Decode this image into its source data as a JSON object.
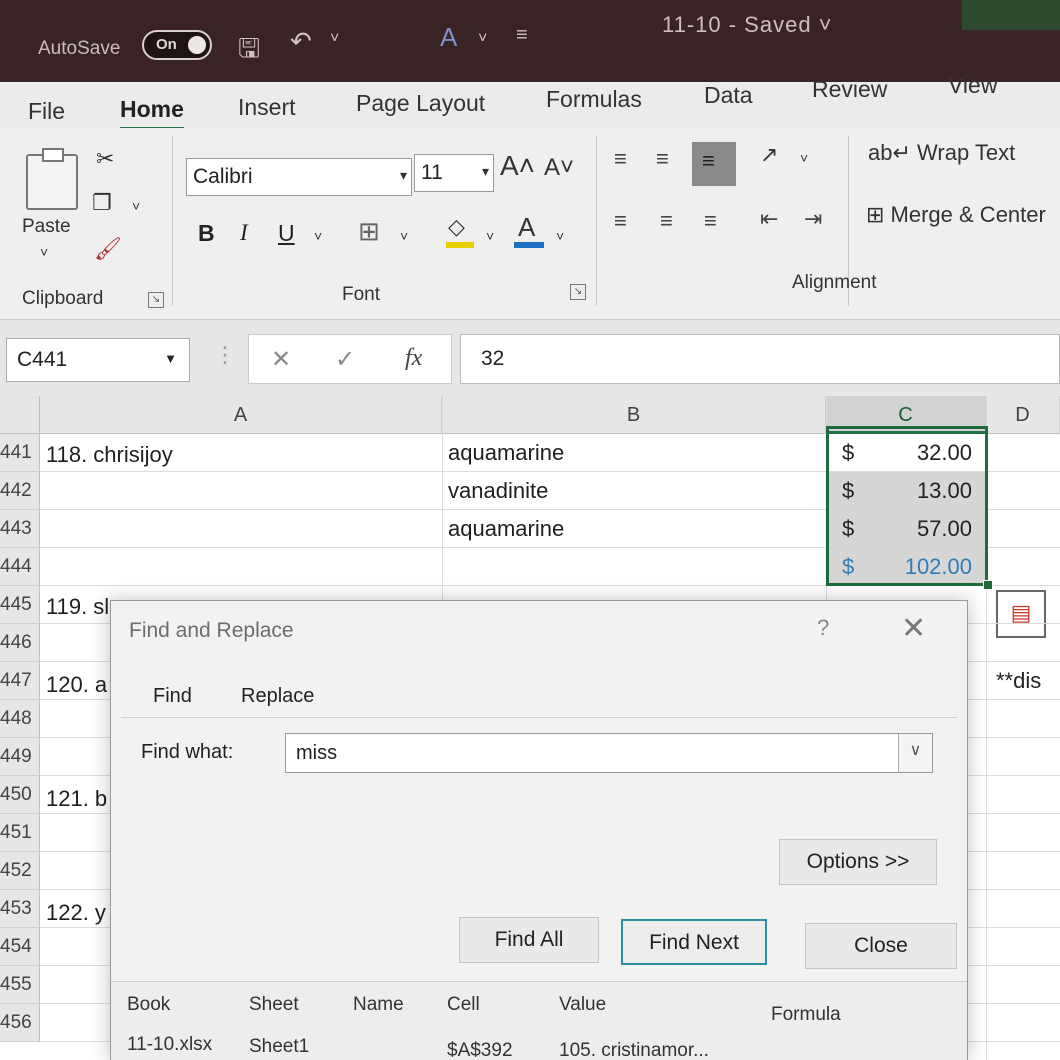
{
  "titlebar": {
    "autosave_label": "AutoSave",
    "autosave_state": "On",
    "doc_title": "11-10 - Saved ˅"
  },
  "ribbon_tabs": [
    {
      "label": "File",
      "active": false
    },
    {
      "label": "Home",
      "active": true
    },
    {
      "label": "Insert",
      "active": false
    },
    {
      "label": "Page Layout",
      "active": false
    },
    {
      "label": "Formulas",
      "active": false
    },
    {
      "label": "Data",
      "active": false
    },
    {
      "label": "Review",
      "active": false
    },
    {
      "label": "View",
      "active": false
    }
  ],
  "clipboard": {
    "paste_label": "Paste",
    "group_label": "Clipboard"
  },
  "font": {
    "family": "Calibri",
    "size": "11",
    "group_label": "Font",
    "bold": "B",
    "italic": "I",
    "underline": "U"
  },
  "alignment": {
    "wrap_text": "Wrap Text",
    "merge_center": "Merge & Center",
    "group_label": "Alignment"
  },
  "formula_bar": {
    "name_box": "C441",
    "formula_value": "32",
    "fx_label": "fx"
  },
  "columns": [
    "A",
    "B",
    "C",
    "D"
  ],
  "rows": [
    {
      "num": "441",
      "a": "118. chrisijoy",
      "b": "aquamarine",
      "c_cur": "$",
      "c_amt": "32.00"
    },
    {
      "num": "442",
      "a": "",
      "b": "vanadinite",
      "c_cur": "$",
      "c_amt": "13.00"
    },
    {
      "num": "443",
      "a": "",
      "b": "aquamarine",
      "c_cur": "$",
      "c_amt": "57.00"
    },
    {
      "num": "444",
      "a": "",
      "b": "",
      "c_cur": "$",
      "c_amt": "102.00"
    },
    {
      "num": "445",
      "a": "119. sl",
      "b": "",
      "c_cur": "",
      "c_amt": ""
    },
    {
      "num": "446",
      "a": "",
      "b": "",
      "c_cur": "",
      "c_amt": ""
    },
    {
      "num": "447",
      "a": "120. a",
      "b": "",
      "c_cur": "",
      "c_amt": ""
    },
    {
      "num": "448",
      "a": "",
      "b": "",
      "c_cur": "",
      "c_amt": ""
    },
    {
      "num": "449",
      "a": "",
      "b": "",
      "c_cur": "",
      "c_amt": ""
    },
    {
      "num": "450",
      "a": "121. b",
      "b": "",
      "c_cur": "",
      "c_amt": ""
    },
    {
      "num": "451",
      "a": "",
      "b": "",
      "c_cur": "",
      "c_amt": ""
    },
    {
      "num": "452",
      "a": "",
      "b": "",
      "c_cur": "",
      "c_amt": ""
    },
    {
      "num": "453",
      "a": "122. y",
      "b": "",
      "c_cur": "",
      "c_amt": ""
    },
    {
      "num": "454",
      "a": "",
      "b": "",
      "c_cur": "",
      "c_amt": ""
    },
    {
      "num": "455",
      "a": "",
      "b": "",
      "c_cur": "",
      "c_amt": ""
    },
    {
      "num": "456",
      "a": "",
      "b": "",
      "c_cur": "",
      "c_amt": ""
    }
  ],
  "partial_d": {
    "row447": "**dis"
  },
  "dialog": {
    "title": "Find and Replace",
    "help": "?",
    "tab_find": "Find",
    "tab_replace": "Replace",
    "find_what_label": "Find what:",
    "find_what_value": "miss",
    "options_button": "Options >>",
    "find_all_button": "Find All",
    "find_next_button": "Find Next",
    "close_button": "Close",
    "results_headers": [
      "Book",
      "Sheet",
      "Name",
      "Cell",
      "Value",
      "Formula"
    ],
    "results_row": {
      "book": "11-10.xlsx",
      "sheet": "Sheet1",
      "name": "",
      "cell": "$A$392",
      "value": "105. cristinamor...",
      "formula": ""
    }
  },
  "colors": {
    "accent": "#217346",
    "title_bar": "#3a2324",
    "dialog_focus": "#2a8fa0",
    "total_text": "#2e7db5"
  }
}
